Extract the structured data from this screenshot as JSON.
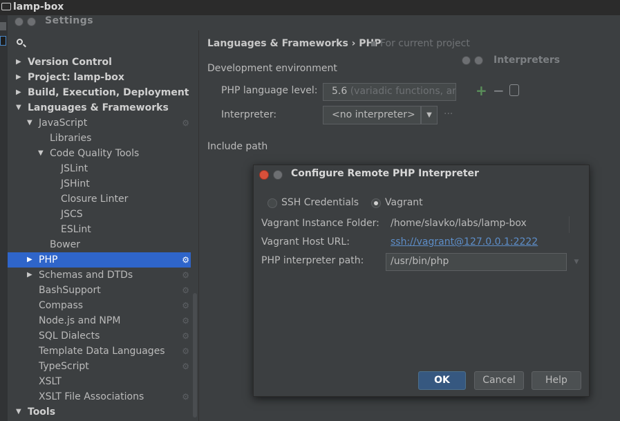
{
  "project": {
    "title": "lamp-box"
  },
  "settings": {
    "title": "Settings"
  },
  "sidebar": {
    "items": [
      {
        "label": "Version Control",
        "arrow": "▶",
        "bold": true,
        "level": 0,
        "gear": false
      },
      {
        "label": "Project: lamp-box",
        "arrow": "▶",
        "bold": true,
        "level": 0,
        "gear": false
      },
      {
        "label": "Build, Execution, Deployment",
        "arrow": "▶",
        "bold": true,
        "level": 0,
        "gear": false
      },
      {
        "label": "Languages & Frameworks",
        "arrow": "▼",
        "bold": true,
        "level": 0,
        "gear": false
      },
      {
        "label": "JavaScript",
        "arrow": "▼",
        "bold": false,
        "level": 1,
        "gear": true
      },
      {
        "label": "Libraries",
        "arrow": "",
        "bold": false,
        "level": 2,
        "gear": false
      },
      {
        "label": "Code Quality Tools",
        "arrow": "▼",
        "bold": false,
        "level": 2,
        "gear": false
      },
      {
        "label": "JSLint",
        "arrow": "",
        "bold": false,
        "level": 3,
        "gear": false
      },
      {
        "label": "JSHint",
        "arrow": "",
        "bold": false,
        "level": 3,
        "gear": false
      },
      {
        "label": "Closure Linter",
        "arrow": "",
        "bold": false,
        "level": 3,
        "gear": false
      },
      {
        "label": "JSCS",
        "arrow": "",
        "bold": false,
        "level": 3,
        "gear": false
      },
      {
        "label": "ESLint",
        "arrow": "",
        "bold": false,
        "level": 3,
        "gear": false
      },
      {
        "label": "Bower",
        "arrow": "",
        "bold": false,
        "level": 2,
        "gear": false
      },
      {
        "label": "PHP",
        "arrow": "▶",
        "bold": false,
        "level": 1,
        "gear": true,
        "selected": true
      },
      {
        "label": "Schemas and DTDs",
        "arrow": "▶",
        "bold": false,
        "level": 1,
        "gear": true
      },
      {
        "label": "BashSupport",
        "arrow": "",
        "bold": false,
        "level": 1,
        "gear": true
      },
      {
        "label": "Compass",
        "arrow": "",
        "bold": false,
        "level": 1,
        "gear": true
      },
      {
        "label": "Node.js and NPM",
        "arrow": "",
        "bold": false,
        "level": 1,
        "gear": true
      },
      {
        "label": "SQL Dialects",
        "arrow": "",
        "bold": false,
        "level": 1,
        "gear": true
      },
      {
        "label": "Template Data Languages",
        "arrow": "",
        "bold": false,
        "level": 1,
        "gear": true
      },
      {
        "label": "TypeScript",
        "arrow": "",
        "bold": false,
        "level": 1,
        "gear": true
      },
      {
        "label": "XSLT",
        "arrow": "",
        "bold": false,
        "level": 1,
        "gear": false
      },
      {
        "label": "XSLT File Associations",
        "arrow": "",
        "bold": false,
        "level": 1,
        "gear": true
      },
      {
        "label": "Tools",
        "arrow": "▼",
        "bold": true,
        "level": 0,
        "gear": false
      }
    ]
  },
  "main": {
    "breadcrumb": "Languages & Frameworks › PHP",
    "scope": "For current project",
    "interpreters_panel_title": "Interpreters",
    "dev_env_label": "Development environment",
    "php_level_label": "PHP language level:",
    "php_level_value": "5.6",
    "php_level_hint": " (variadic functions, arg",
    "interpreter_label": "Interpreter:",
    "interpreter_value": "<no interpreter>",
    "interpreter_more": "...",
    "include_path_label": "Include path"
  },
  "dialog": {
    "title": "Configure Remote PHP Interpreter",
    "radio_ssh": "SSH Credentials",
    "radio_vagrant": "Vagrant",
    "selected_option": "Vagrant",
    "folder_label": "Vagrant Instance Folder:",
    "folder_value": "/home/slavko/labs/lamp-box",
    "host_url_label": "Vagrant Host URL:",
    "host_url_value": "ssh://vagrant@127.0.0.1:2222",
    "interp_path_label": "PHP interpreter path:",
    "interp_path_value": "/usr/bin/php",
    "ok": "OK",
    "cancel": "Cancel",
    "help": "Help"
  },
  "colors": {
    "background": "#3c3f41",
    "selection": "#2f65ca",
    "ok_button": "#365880",
    "close_button": "#d8503a",
    "link": "#5d8ec9"
  }
}
